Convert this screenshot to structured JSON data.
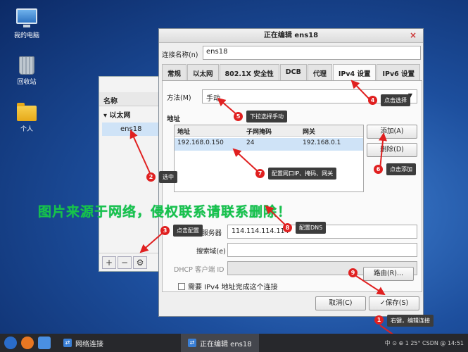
{
  "desktop": {
    "icons": [
      {
        "label": "我的电脑"
      },
      {
        "label": "回收站"
      },
      {
        "label": "个人"
      }
    ]
  },
  "back_window": {
    "column_header": "名称",
    "group": "▾ 以太网",
    "selected": "ens18",
    "buttons": [
      "+",
      "−",
      "⚙"
    ]
  },
  "dialog": {
    "title": "正在编辑 ens18",
    "close": "×",
    "connection_name_label": "连接名称(n)",
    "connection_name_value": "ens18",
    "tabs": [
      "常规",
      "以太网",
      "802.1X 安全性",
      "DCB",
      "代理",
      "IPv4 设置",
      "IPv6 设置"
    ],
    "active_tab": "IPv4 设置",
    "method_label": "方法(M)",
    "method_value": "手动",
    "address_label": "地址",
    "table": {
      "headers": [
        "地址",
        "子网掩码",
        "网关"
      ],
      "rows": [
        [
          "192.168.0.150",
          "24",
          "192.168.0.1"
        ]
      ]
    },
    "add_button": "添加(A)",
    "delete_button": "删除(D)",
    "dns_label": "DNS 服务器",
    "dns_value": "114.114.114.114",
    "search_label": "搜索域(e)",
    "dhcp_label": "DHCP 客户端 ID",
    "require_ipv4_label": "需要 IPv4 地址完成这个连接",
    "routes_button": "路由(R)...",
    "cancel_button": "取消(C)",
    "save_button": "✓保存(S)"
  },
  "annotations": [
    {
      "num": "1",
      "text": "右键，编辑连接"
    },
    {
      "num": "2",
      "text": "选中"
    },
    {
      "num": "3",
      "text": "点击配置"
    },
    {
      "num": "4",
      "text": "点击选择"
    },
    {
      "num": "5",
      "text": "下拉选择手动"
    },
    {
      "num": "6",
      "text": "点击添加"
    },
    {
      "num": "7",
      "text": "配置网口IP、掩码、网关"
    },
    {
      "num": "8",
      "text": "配置DNS"
    },
    {
      "num": "9",
      "text": ""
    }
  ],
  "watermark": "图片来源于网络，侵权联系请联系删除！",
  "taskbar": {
    "tasks": [
      "网络连接",
      "正在编辑 ens18"
    ],
    "tray": "中 ⊙ ⊕ 1 25°  CSDN @ 14:51"
  }
}
